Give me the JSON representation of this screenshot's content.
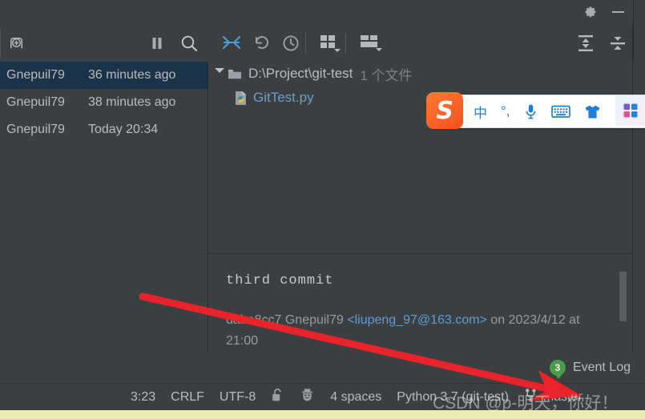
{
  "window": {
    "gear_icon": "gear-icon",
    "minimize_icon": "minimize-icon"
  },
  "toolbar_left": {
    "new_branch_icon": "new-branch-icon",
    "pause_icon": "pause-icon",
    "search_icon": "search-icon"
  },
  "toolbar_right": {
    "collapse_arrows_icon": "collapse-arrows-icon",
    "revert_icon": "revert-icon",
    "history_icon": "history-clock-icon",
    "layout_grid_icon": "layout-grid-dropdown-icon",
    "layout_rows_icon": "layout-rows-dropdown-icon",
    "expand_all_icon": "expand-all-icon",
    "collapse_all_icon": "collapse-all-icon"
  },
  "commit_list": {
    "rows": [
      {
        "author": "Gnepuil79",
        "date": "36 minutes ago",
        "selected": true
      },
      {
        "author": "Gnepuil79",
        "date": "38 minutes ago",
        "selected": false
      },
      {
        "author": "Gnepuil79",
        "date": "Today 20:34",
        "selected": false
      }
    ]
  },
  "changed_files": {
    "folder_icon": "folder-icon",
    "expand_triangle_icon": "triangle-down-icon",
    "path": "D:\\Project\\git-test",
    "count": "1 个文件",
    "file_icon": "python-file-icon",
    "file_name": "GitTest.py"
  },
  "commit_detail": {
    "message": "third commit",
    "hash": "daba8cc7",
    "author": "Gnepuil79",
    "email": "<liupeng_97@163.com>",
    "on_word": "on",
    "date": "2023/4/12 at 21:00",
    "scrollbar": "vertical-scrollbar"
  },
  "event_log": {
    "count": "3",
    "label": "Event Log"
  },
  "status_bar": {
    "caret_position": "3:23",
    "line_separator": "CRLF",
    "encoding": "UTF-8",
    "lock_icon": "unlocked-padlock-icon",
    "inspection_icon": "inspection-hat-icon",
    "indent": "4 spaces",
    "interpreter": "Python 3.7 (git-test)",
    "branch_icon": "git-branch-icon",
    "branch": "master"
  },
  "ime_toolbar": {
    "logo": "S",
    "logo_name": "sogou-logo-icon",
    "lang_label": "中",
    "punctuation_label": "°,",
    "mic_icon": "microphone-icon",
    "keyboard_icon": "soft-keyboard-icon",
    "skin_icon": "tshirt-skin-icon",
    "menu_icon": "four-square-menu-icon"
  },
  "annotation": {
    "arrow_color": "#e8232a",
    "arrow_name": "red-pointer-arrow"
  },
  "watermark": {
    "text": "CSDN @p-明天，你好！"
  },
  "colors": {
    "panel_bg": "#3c3f41",
    "selected_row": "#1b3348",
    "link_blue": "#5b9bd5",
    "file_blue": "#68a0c8",
    "badge_green": "#4a9d4a",
    "ime_blue": "#1d7fd9",
    "bottom_strip": "#eeeab4"
  }
}
